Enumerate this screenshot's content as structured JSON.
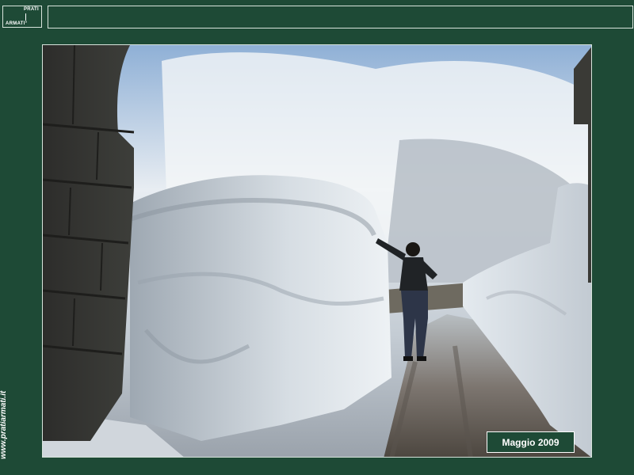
{
  "logo": {
    "line1": "PRATI",
    "line2": "ARMATI°"
  },
  "sidebar": {
    "url_text": "www.pratiarmati.it"
  },
  "photo": {
    "caption": "Maggio  2009"
  },
  "colors": {
    "background": "#1e4a36",
    "border": "#d8e4dc",
    "text": "#ffffff"
  }
}
